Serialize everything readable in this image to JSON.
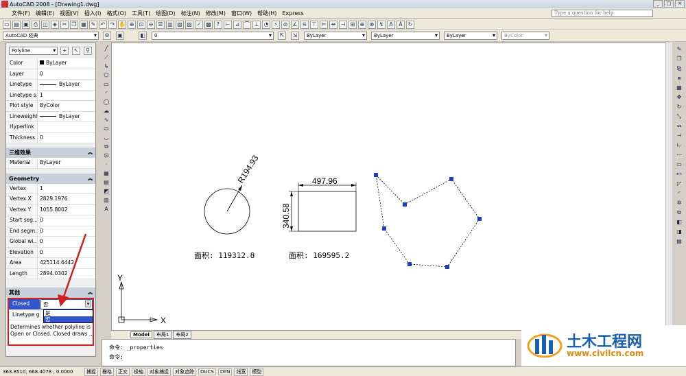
{
  "window": {
    "title": "AutoCAD 2008 - [Drawing1.dwg]",
    "search_placeholder": "Type a question for help",
    "btn_min": "_",
    "btn_max": "□",
    "btn_close": "×"
  },
  "menu": [
    "文件(F)",
    "编辑(E)",
    "视图(V)",
    "插入(I)",
    "格式(O)",
    "工具(T)",
    "绘图(D)",
    "标注(N)",
    "修改(M)",
    "窗口(W)",
    "帮助(H)",
    "Express"
  ],
  "toolbar2": {
    "workspace": "AutoCAD 经典",
    "layer": "0",
    "color": "ByLayer",
    "linetype": "ByLayer",
    "lineweight": "ByLayer",
    "plotstyle": "ByColor"
  },
  "properties": {
    "object_type": "Polyline",
    "general": [
      {
        "k": "Color",
        "v": "ByLayer"
      },
      {
        "k": "Layer",
        "v": "0"
      },
      {
        "k": "Linetype",
        "v": "ByLayer"
      },
      {
        "k": "Linetype s...",
        "v": "1"
      },
      {
        "k": "Plot style",
        "v": "ByColor"
      },
      {
        "k": "Lineweight",
        "v": "ByLayer"
      },
      {
        "k": "Hyperlink",
        "v": ""
      },
      {
        "k": "Thickness",
        "v": "0"
      }
    ],
    "section_3d": "三维效果",
    "material": {
      "k": "Material",
      "v": "ByLayer"
    },
    "section_geometry": "Geometry",
    "geometry": [
      {
        "k": "Vertex",
        "v": "1"
      },
      {
        "k": "Vertex X",
        "v": "2829.1976"
      },
      {
        "k": "Vertex Y",
        "v": "1055.8002"
      },
      {
        "k": "Start seg...",
        "v": "0"
      },
      {
        "k": "End segm...",
        "v": "0"
      },
      {
        "k": "Global wi...",
        "v": "0"
      },
      {
        "k": "Elevation",
        "v": "0"
      },
      {
        "k": "Area",
        "v": "425114.6442"
      },
      {
        "k": "Length",
        "v": "2894.0302"
      }
    ],
    "section_other": "其他",
    "closed": {
      "k": "Closed",
      "v": "否"
    },
    "linetype_gen": {
      "k": "Linetype g...",
      "v": "是"
    },
    "dropdown_options": [
      "是",
      "否"
    ],
    "description": "Determines whether polyline is Open or Closed. Closed draws ..."
  },
  "drawing": {
    "dim_radius": "R194.93",
    "dim_width": "497.96",
    "dim_height": "340.58",
    "area_circle": "面积: 119312.8",
    "area_rect": "面积: 169595.2",
    "axis_x": "X",
    "axis_y": "Y"
  },
  "tabs": [
    "Model",
    "布局1",
    "布局2"
  ],
  "command": {
    "line1": "命令: _properties",
    "line2": "命令:"
  },
  "status": {
    "coords": "363.8510, 668.4078 , 0.0000",
    "buttons": [
      "捕捉",
      "栅格",
      "正交",
      "极轴",
      "对象捕捉",
      "对象追踪",
      "DUCS",
      "DYN",
      "线宽",
      "模型"
    ]
  },
  "watermark": {
    "title": "土木工程网",
    "url": "www.civilcn.com"
  },
  "colors": {
    "accent": "#0a3aa8",
    "highlight": "#3355cc",
    "grip": "#1a3cc8",
    "arrow": "#d02020"
  }
}
